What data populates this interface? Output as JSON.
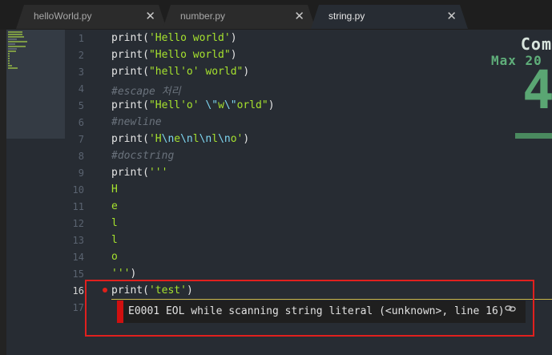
{
  "tabs": [
    {
      "label": "helloWorld.py",
      "close": "✕",
      "active": false
    },
    {
      "label": "number.py",
      "close": "✕",
      "active": false
    },
    {
      "label": "string.py",
      "close": "✕",
      "active": true
    }
  ],
  "line_numbers": [
    "1",
    "2",
    "3",
    "4",
    "5",
    "6",
    "7",
    "8",
    "9",
    "10",
    "11",
    "12",
    "13",
    "14",
    "15",
    "16",
    "17"
  ],
  "code": {
    "l1": [
      "print(",
      "'Hello world'",
      ")"
    ],
    "l2": [
      "print(",
      "\"Hello world\"",
      ")"
    ],
    "l3": [
      "print(",
      "\"hell'o' world\"",
      ")"
    ],
    "l4": "#escape 처리",
    "l5": [
      "print(",
      "\"Hell'o' ",
      "\\\"",
      "w",
      "\\\"",
      "orld\"",
      ")"
    ],
    "l6": "#newline",
    "l7": [
      "print(",
      "'H",
      "\\n",
      "e",
      "\\n",
      "l",
      "\\n",
      "l",
      "\\n",
      "o'",
      ")"
    ],
    "l8": "#docstring",
    "l9": [
      "print(",
      "'''"
    ],
    "l10": "H",
    "l11": "e",
    "l12": "l",
    "l13": "l",
    "l14": "o",
    "l15": [
      "'''",
      ")"
    ],
    "l16": [
      "print(",
      "'test'",
      ")"
    ]
  },
  "error_tooltip": {
    "message": "E0001 EOL while scanning string literal (<unknown>, line 16)",
    "link_icon": "link-icon"
  },
  "overlay": {
    "top_text": "Com",
    "max_text": "Max 20",
    "big_digit": "4"
  },
  "colors": {
    "editor_bg": "#272c33",
    "string": "#a6e22e",
    "comment": "#6b737d",
    "escape": "#7fd6f0",
    "error": "#e0201e"
  }
}
